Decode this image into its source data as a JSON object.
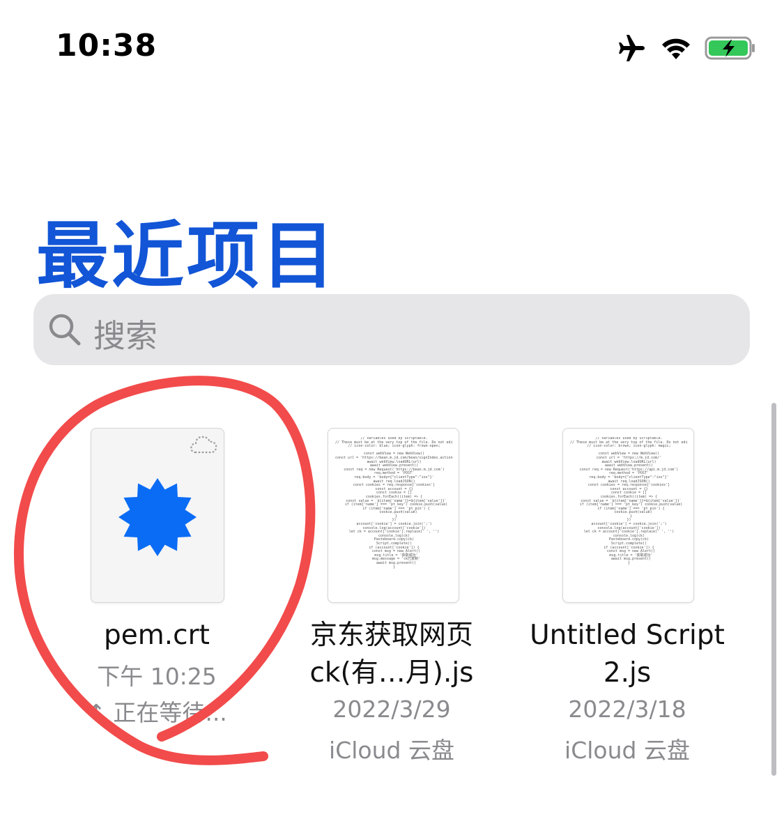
{
  "status_bar": {
    "time": "10:38",
    "icons": [
      "airplane-icon",
      "wifi-icon",
      "battery-charging-icon"
    ],
    "battery_color": "#34c759"
  },
  "page": {
    "title": "最近项目",
    "title_color": "#1255d6"
  },
  "search": {
    "placeholder": "搜索"
  },
  "files": [
    {
      "name": "pem.crt",
      "date": "下午 10:25",
      "status": "↑ 正在等待...",
      "icon": "certificate-seal-icon",
      "accent": "#0a6cf5"
    },
    {
      "name_line1": "京东获取网页",
      "name_line2": "ck(有…月).js",
      "date": "2022/3/29",
      "location": "iCloud 云盘",
      "icon": "script-preview"
    },
    {
      "name_line1": "Untitled Script",
      "name_line2": "2.js",
      "date": "2022/3/18",
      "location": "iCloud 云盘",
      "icon": "script-preview"
    }
  ],
  "annotation": {
    "color": "#f24b4b"
  }
}
